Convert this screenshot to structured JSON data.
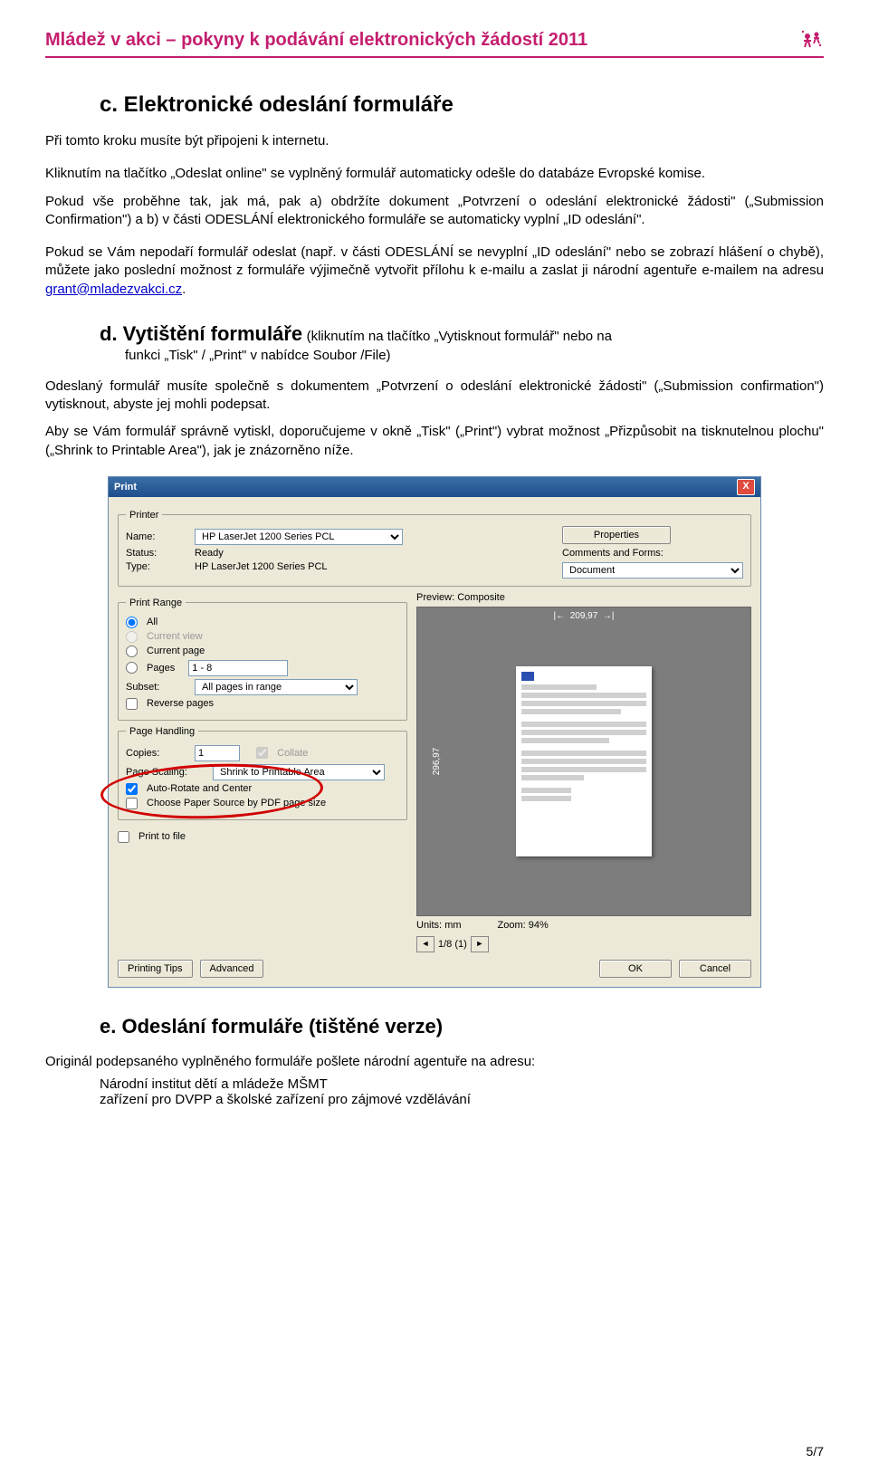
{
  "header": {
    "title": "Mládež v akci – pokyny k podávání elektronických žádostí 2011"
  },
  "section_c": {
    "title": "c. Elektronické odeslání formuláře",
    "p1": "Při tomto kroku musíte být připojeni k internetu.",
    "p2": "Kliknutím na tlačítko „Odeslat online\" se vyplněný formulář automaticky odešle do databáze Evropské komise.",
    "p3": "Pokud vše proběhne tak, jak má, pak a) obdržíte dokument „Potvrzení o odeslání elektronické žádosti\" („Submission Confirmation\") a b) v části ODESLÁNÍ elektronického formuláře se automaticky vyplní „ID odeslání\".",
    "p4a": "Pokud se Vám nepodaří formulář odeslat (např. v části ODESLÁNÍ se nevyplní „ID odeslání\" nebo se zobrazí hlášení o chybě), můžete jako poslední možnost z formuláře výjimečně vytvořit přílohu k e-mailu a zaslat ji národní agentuře e-mailem na adresu ",
    "p4mail": "grant@mladezvakci.cz",
    "p4b": "."
  },
  "section_d": {
    "lead": "d. Vytištění formuláře",
    "tail": "(kliknutím na tlačítko „Vytisknout formulář\" nebo na",
    "line2": "funkci „Tisk\" / „Print\" v nabídce Soubor /File)",
    "p1": "Odeslaný formulář musíte společně s dokumentem „Potvrzení o odeslání elektronické žádosti\" („Submission confirmation\") vytisknout, abyste jej mohli podepsat.",
    "p2": "Aby se Vám formulář správně vytiskl, doporučujeme v okně „Tisk\" („Print\") vybrat možnost „Přizpůsobit na tisknutelnou plochu\" („Shrink to Printable Area\"), jak je znázorněno níže."
  },
  "print_dialog": {
    "title": "Print",
    "close": "X",
    "printer_legend": "Printer",
    "name_lbl": "Name:",
    "name_val": "HP LaserJet 1200 Series PCL",
    "status_lbl": "Status:",
    "status_val": "Ready",
    "type_lbl": "Type:",
    "type_val": "HP LaserJet 1200 Series PCL",
    "properties_btn": "Properties",
    "comments_lbl": "Comments and Forms:",
    "comments_val": "Document",
    "range_legend": "Print Range",
    "r_all": "All",
    "r_view": "Current view",
    "r_page": "Current page",
    "r_pages": "Pages",
    "r_pages_val": "1 - 8",
    "subset_lbl": "Subset:",
    "subset_val": "All pages in range",
    "reverse": "Reverse pages",
    "handling_legend": "Page Handling",
    "copies_lbl": "Copies:",
    "copies_val": "1",
    "collate": "Collate",
    "scaling_lbl": "Page Scaling:",
    "scaling_val": "Shrink to Printable Area",
    "autorotate": "Auto-Rotate and Center",
    "choose_src": "Choose Paper Source by PDF page size",
    "p2f": "Print to file",
    "preview_lbl": "Preview: Composite",
    "dim_w": "209,97",
    "dim_h": "296,97",
    "units_lbl": "Units:",
    "units_val": "mm",
    "zoom_lbl": "Zoom:",
    "zoom_val": "94%",
    "page_ind": "1/8 (1)",
    "tips_btn": "Printing Tips",
    "adv_btn": "Advanced",
    "ok_btn": "OK",
    "cancel_btn": "Cancel"
  },
  "section_e": {
    "title": "e. Odeslání formuláře (tištěné verze)",
    "p1": "Originál podepsaného vyplněného formuláře pošlete národní agentuře na adresu:",
    "addr1": "Národní institut dětí a mládeže MŠMT",
    "addr2": "zařízení pro DVPP a školské zařízení pro zájmové vzdělávání"
  },
  "page_number": "5/7"
}
